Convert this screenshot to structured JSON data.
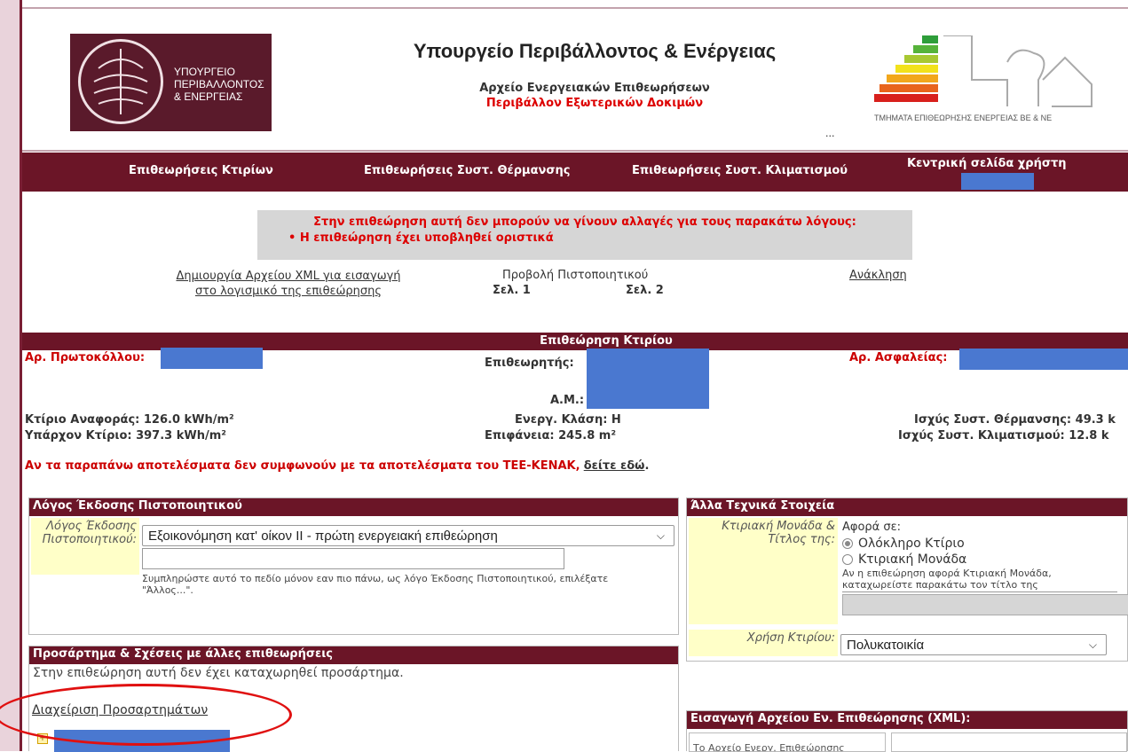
{
  "header": {
    "logo_lines": [
      "ΥΠΟΥΡΓΕΙΟ",
      "ΠΕΡΙΒΑΛΛΟΝΤΟΣ",
      "& ΕΝΕΡΓΕΙΑΣ"
    ],
    "ministry_title": "Υπουργείο Περιβάλλοντος & Ενέργειας",
    "archive_title": "Αρχείο Ενεργειακών Επιθεωρήσεων",
    "environment": "Περιβάλλον Εξωτερικών Δοκιμών",
    "dots": "...",
    "dept": "ΤΜΗΜΑΤΑ ΕΠΙΘΕΩΡΗΣΗΣ ΕΝΕΡΓΕΙΑΣ ΒΕ & ΝΕ"
  },
  "nav": {
    "buildings": "Επιθεωρήσεις Κτιρίων",
    "heating": "Επιθεωρήσεις Συστ. Θέρμανσης",
    "cooling": "Επιθεωρήσεις Συστ. Κλιματισμού",
    "user_home": "Κεντρική σελίδα χρήστη"
  },
  "warning": {
    "title": "Στην επιθεώρηση αυτή δεν μπορούν να γίνουν αλλαγές για τους παρακάτω λόγους:",
    "item": "• Η επιθεώρηση έχει υποβληθεί οριστικά"
  },
  "actions": {
    "xml_link": "Δημιουργία Αρχείου XML για εισαγωγή στο λογισμικό της επιθεώρησης",
    "cert_label": "Προβολή Πιστοποιητικού",
    "page1": "Σελ. 1",
    "page2": "Σελ. 2",
    "revoke": "Ανάκληση"
  },
  "inspection": {
    "section_title": "Επιθεώρηση Κτιρίου",
    "protocol_label": "Αρ. Πρωτοκόλλου:",
    "inspector_label": "Επιθεωρητής:",
    "am_label": "Α.Μ.:",
    "insurance_label": "Αρ. Ασφαλείας:",
    "ref_building": "Κτίριο Αναφοράς: 126.0 kWh/m²",
    "existing_building": "Υπάρχον Κτίριο: 397.3 kWh/m²",
    "energy_class": "Ενεργ. Κλάση: Η",
    "area": "Επιφάνεια: 245.8 m²",
    "heating_power": "Ισχύς Συστ. Θέρμανσης: 49.3 k",
    "cooling_power": "Ισχύς Συστ. Κλιματισμού: 12.8 k",
    "mismatch_text": "Αν τα παραπάνω αποτελέσματα δεν συμφωνούν με τα αποτελέσματα του ΤΕΕ-ΚΕΝΑΚ,",
    "mismatch_link": "δείτε εδώ",
    "mismatch_end": "."
  },
  "reason_panel": {
    "title": "Λόγος Έκδοσης Πιστοποιητικού",
    "label": "Λόγος Έκδοσης Πιστοποιητικού:",
    "selected": "Εξοικονόμηση κατ' οίκον ΙΙ - πρώτη ενεργειακή επιθεώρηση",
    "other_value": "",
    "hint": "Συμπληρώστε αυτό το πεδίο μόνον εαν πιο πάνω, ως λόγο Έκδοσης Πιστοποιητικού, επιλέξατε \"Άλλος...\"."
  },
  "tech_panel": {
    "title": "Άλλα Τεχνικά Στοιχεία",
    "unit_label": "Κτιριακή Μονάδα & Τίτλος της:",
    "concerns": "Αφορά σε:",
    "opt_whole": "Ολόκληρο Κτίριο",
    "opt_unit": "Κτιριακή Μονάδα",
    "unit_hint": "Αν η επιθεώρηση αφορά Κτιριακή Μονάδα, καταχωρείστε παρακάτω τον τίτλο της",
    "use_label": "Χρήση Κτιρίου:",
    "use_selected": "Πολυκατοικία"
  },
  "attach_panel": {
    "title": "Προσάρτημα & Σχέσεις με άλλες επιθεωρήσεις",
    "empty_msg": "Στην επιθεώρηση αυτή δεν έχει καταχωρηθεί προσάρτημα.",
    "manage_link": "Διαχείριση Προσαρτημάτων"
  },
  "xml_panel": {
    "title": "Εισαγωγή Αρχείου Εν. Επιθεώρησης (XML):",
    "file_label": "Το Αρχείο Ενεργ. Επιθεώρησης"
  },
  "colors": {
    "brand": "#6b1527",
    "warning_red": "#cc0000",
    "redacted": "#4a78d0",
    "highlight": "#e01010"
  }
}
